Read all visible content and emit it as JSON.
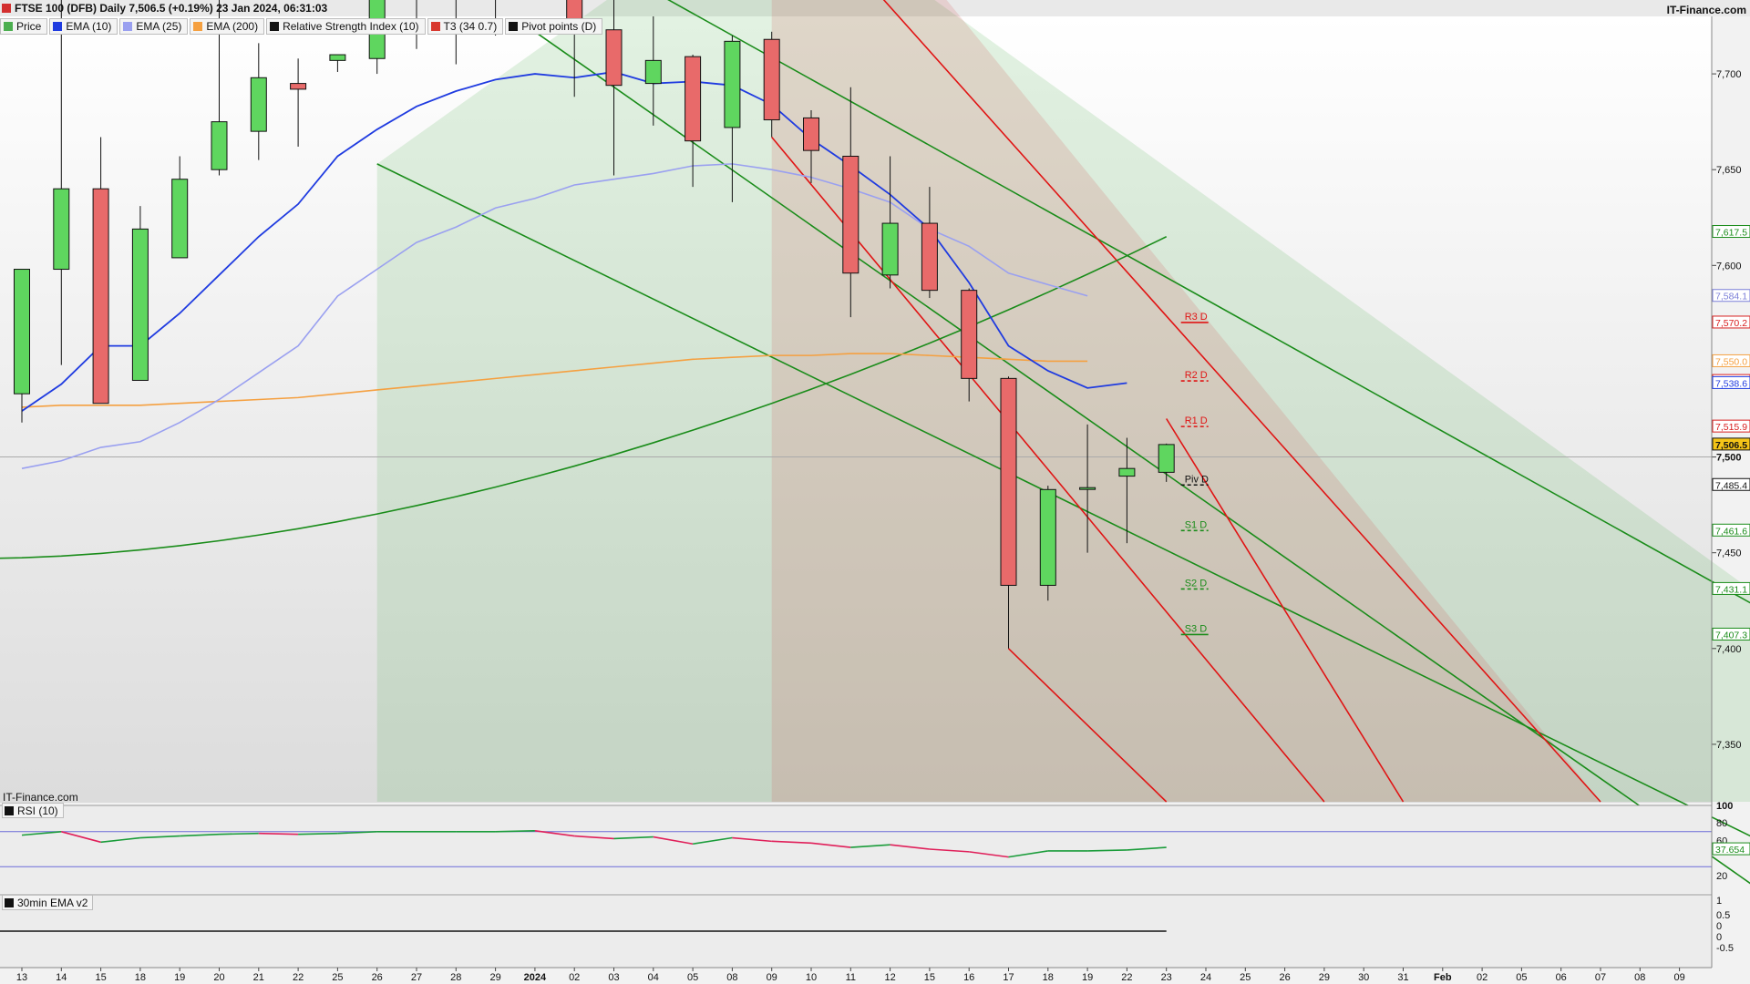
{
  "header": {
    "title": "FTSE 100 (DFB) Daily 7,506.5 (+0.19%) 23 Jan 2024, 06:31:03",
    "brand": "IT-Finance.com",
    "watermark": "IT-Finance.com"
  },
  "legend": [
    {
      "label": "Price",
      "color": "#4caf50"
    },
    {
      "label": "EMA (10)",
      "color": "#1f3be0"
    },
    {
      "label": "EMA (25)",
      "color": "#9aa0f0"
    },
    {
      "label": "EMA (200)",
      "color": "#f5a040"
    },
    {
      "label": "Relative Strength Index (10)",
      "color": "#111111"
    },
    {
      "label": "T3 (34 0.7)",
      "color": "#d8382e"
    },
    {
      "label": "Pivot points (D)",
      "color": "#111111"
    }
  ],
  "panels": {
    "rsi_label": "RSI (10)",
    "ema30_label": "30min EMA v2"
  },
  "colors": {
    "up": "#5fd65f",
    "down": "#e86a6a",
    "ema10": "#1f3be0",
    "ema25": "#9aa0f0",
    "ema200": "#f5a040",
    "channel_green": "#1a8c1a",
    "channel_red": "#e01414"
  },
  "chart_data": {
    "type": "candlestick",
    "ylim": [
      7320,
      7730
    ],
    "y_ticks": [
      "7,700",
      "7,650",
      "7,600",
      "7,550",
      "7,500",
      "7,450",
      "7,400",
      "7,350"
    ],
    "x_labels": [
      "13",
      "14",
      "15",
      "18",
      "19",
      "20",
      "21",
      "22",
      "25",
      "26",
      "27",
      "28",
      "29",
      "2024",
      "02",
      "03",
      "04",
      "05",
      "08",
      "09",
      "10",
      "11",
      "12",
      "15",
      "16",
      "17",
      "18",
      "19",
      "22",
      "23",
      "24",
      "25",
      "26",
      "29",
      "30",
      "31",
      "Feb",
      "02",
      "05",
      "06",
      "07",
      "08",
      "09"
    ],
    "candles": [
      {
        "o": 7533,
        "h": 7560,
        "l": 7518,
        "c": 7598
      },
      {
        "o": 7598,
        "h": 7752,
        "l": 7548,
        "c": 7640
      },
      {
        "o": 7640,
        "h": 7667,
        "l": 7549,
        "c": 7528
      },
      {
        "o": 7540,
        "h": 7631,
        "l": 7553,
        "c": 7619
      },
      {
        "o": 7604,
        "h": 7657,
        "l": 7605,
        "c": 7645
      },
      {
        "o": 7650,
        "h": 7750,
        "l": 7647,
        "c": 7675
      },
      {
        "o": 7670,
        "h": 7716,
        "l": 7655,
        "c": 7698
      },
      {
        "o": 7695,
        "h": 7708,
        "l": 7662,
        "c": 7692
      },
      {
        "o": 7707,
        "h": 7709,
        "l": 7701,
        "c": 7710
      },
      {
        "o": 7708,
        "h": 7736,
        "l": 7700,
        "c": 7744
      },
      {
        "o": 7740,
        "h": 7745,
        "l": 7713,
        "c": 7745
      },
      {
        "o": 7740,
        "h": 7745,
        "l": 7705,
        "c": 7742
      },
      {
        "o": 7742,
        "h": 7743,
        "l": 7720,
        "c": 7741
      },
      {
        "o": 7744,
        "h": 7770,
        "l": 7740,
        "c": 7760
      },
      {
        "o": 7760,
        "h": 7752,
        "l": 7688,
        "c": 7728
      },
      {
        "o": 7723,
        "h": 7742,
        "l": 7647,
        "c": 7694
      },
      {
        "o": 7695,
        "h": 7730,
        "l": 7673,
        "c": 7707
      },
      {
        "o": 7709,
        "h": 7710,
        "l": 7641,
        "c": 7665
      },
      {
        "o": 7672,
        "h": 7720,
        "l": 7633,
        "c": 7717
      },
      {
        "o": 7718,
        "h": 7722,
        "l": 7667,
        "c": 7676
      },
      {
        "o": 7677,
        "h": 7681,
        "l": 7643,
        "c": 7660
      },
      {
        "o": 7657,
        "h": 7693,
        "l": 7573,
        "c": 7596
      },
      {
        "o": 7595,
        "h": 7657,
        "l": 7588,
        "c": 7622
      },
      {
        "o": 7622,
        "h": 7641,
        "l": 7583,
        "c": 7587
      },
      {
        "o": 7587,
        "h": 7588,
        "l": 7529,
        "c": 7541
      },
      {
        "o": 7541,
        "h": 7542,
        "l": 7400,
        "c": 7433
      },
      {
        "o": 7433,
        "h": 7485,
        "l": 7425,
        "c": 7483
      },
      {
        "o": 7484,
        "h": 7517,
        "l": 7450,
        "c": 7484
      },
      {
        "o": 7490,
        "h": 7510,
        "l": 7455,
        "c": 7494
      },
      {
        "o": 7492,
        "h": 7507,
        "l": 7487,
        "c": 7506.5
      }
    ],
    "ema10": [
      7524,
      7538,
      7558,
      7558,
      7575,
      7595,
      7615,
      7632,
      7657,
      7671,
      7683,
      7691,
      7697,
      7700,
      7698,
      7701,
      7695,
      7696,
      7694,
      7684,
      7666,
      7652,
      7637,
      7619,
      7591,
      7558,
      7545,
      7536,
      7538.6
    ],
    "ema25": [
      7494,
      7498,
      7505,
      7508,
      7518,
      7530,
      7544,
      7558,
      7584,
      7598,
      7612,
      7620,
      7630,
      7635,
      7642,
      7645,
      7648,
      7652,
      7653,
      7650,
      7646,
      7640,
      7633,
      7619,
      7610,
      7596,
      7590,
      7584.1
    ],
    "ema200": [
      7526,
      7527,
      7527,
      7527,
      7528,
      7529,
      7530,
      7531,
      7533,
      7535,
      7537,
      7539,
      7541,
      7543,
      7545,
      7547,
      7549,
      7551,
      7552,
      7553,
      7553,
      7554,
      7554,
      7553,
      7552,
      7551,
      7550,
      7550.0
    ],
    "pivots": [
      {
        "name": "R3 D",
        "value": 7570.2
      },
      {
        "name": "R2 D",
        "value": 7539.7
      },
      {
        "name": "R1 D",
        "value": 7515.9
      },
      {
        "name": "Piv D",
        "value": 7485.4
      },
      {
        "name": "S1 D",
        "value": 7461.6
      },
      {
        "name": "S2 D",
        "value": 7431.1
      },
      {
        "name": "S3 D",
        "value": 7407.3
      }
    ],
    "price_labels": [
      {
        "text": "7,617.5",
        "color": "#1a8c1a",
        "value": 7617.5
      },
      {
        "text": "7,584.1",
        "color": "#7b7fd8",
        "value": 7584.1
      },
      {
        "text": "7,570.2",
        "color": "#d82020",
        "value": 7570.2
      },
      {
        "text": "7,550.0",
        "color": "#f5a040",
        "value": 7550.0
      },
      {
        "text": "7,539.7",
        "color": "#d82020",
        "value": 7539.7
      },
      {
        "text": "7,538.6",
        "color": "#1f3be0",
        "value": 7538.6
      },
      {
        "text": "7,515.9",
        "color": "#d82020",
        "value": 7515.9
      },
      {
        "text": "7,506.5",
        "color": "#111111",
        "value": 7506.5
      },
      {
        "text": "7,485.4",
        "color": "#111111",
        "value": 7485.4
      },
      {
        "text": "7,461.6",
        "color": "#1a8c1a",
        "value": 7461.6
      },
      {
        "text": "7,431.1",
        "color": "#1a8c1a",
        "value": 7431.1
      },
      {
        "text": "7,407.3",
        "color": "#1a8c1a",
        "value": 7407.3
      }
    ],
    "rsi": {
      "ylim": [
        0,
        100
      ],
      "ticks": [
        "100",
        "80",
        "60",
        "20"
      ],
      "values": [
        66,
        70,
        58,
        63,
        65,
        67,
        68,
        67,
        68,
        70,
        70,
        70,
        70,
        71,
        65,
        62,
        64,
        56,
        63,
        59,
        57,
        52,
        55,
        50,
        47,
        41,
        48,
        48,
        49,
        52
      ],
      "last_label": "37.654"
    },
    "ema30": {
      "ticks": [
        "1",
        "0.5",
        "0",
        "0",
        "-0.5"
      ]
    }
  }
}
